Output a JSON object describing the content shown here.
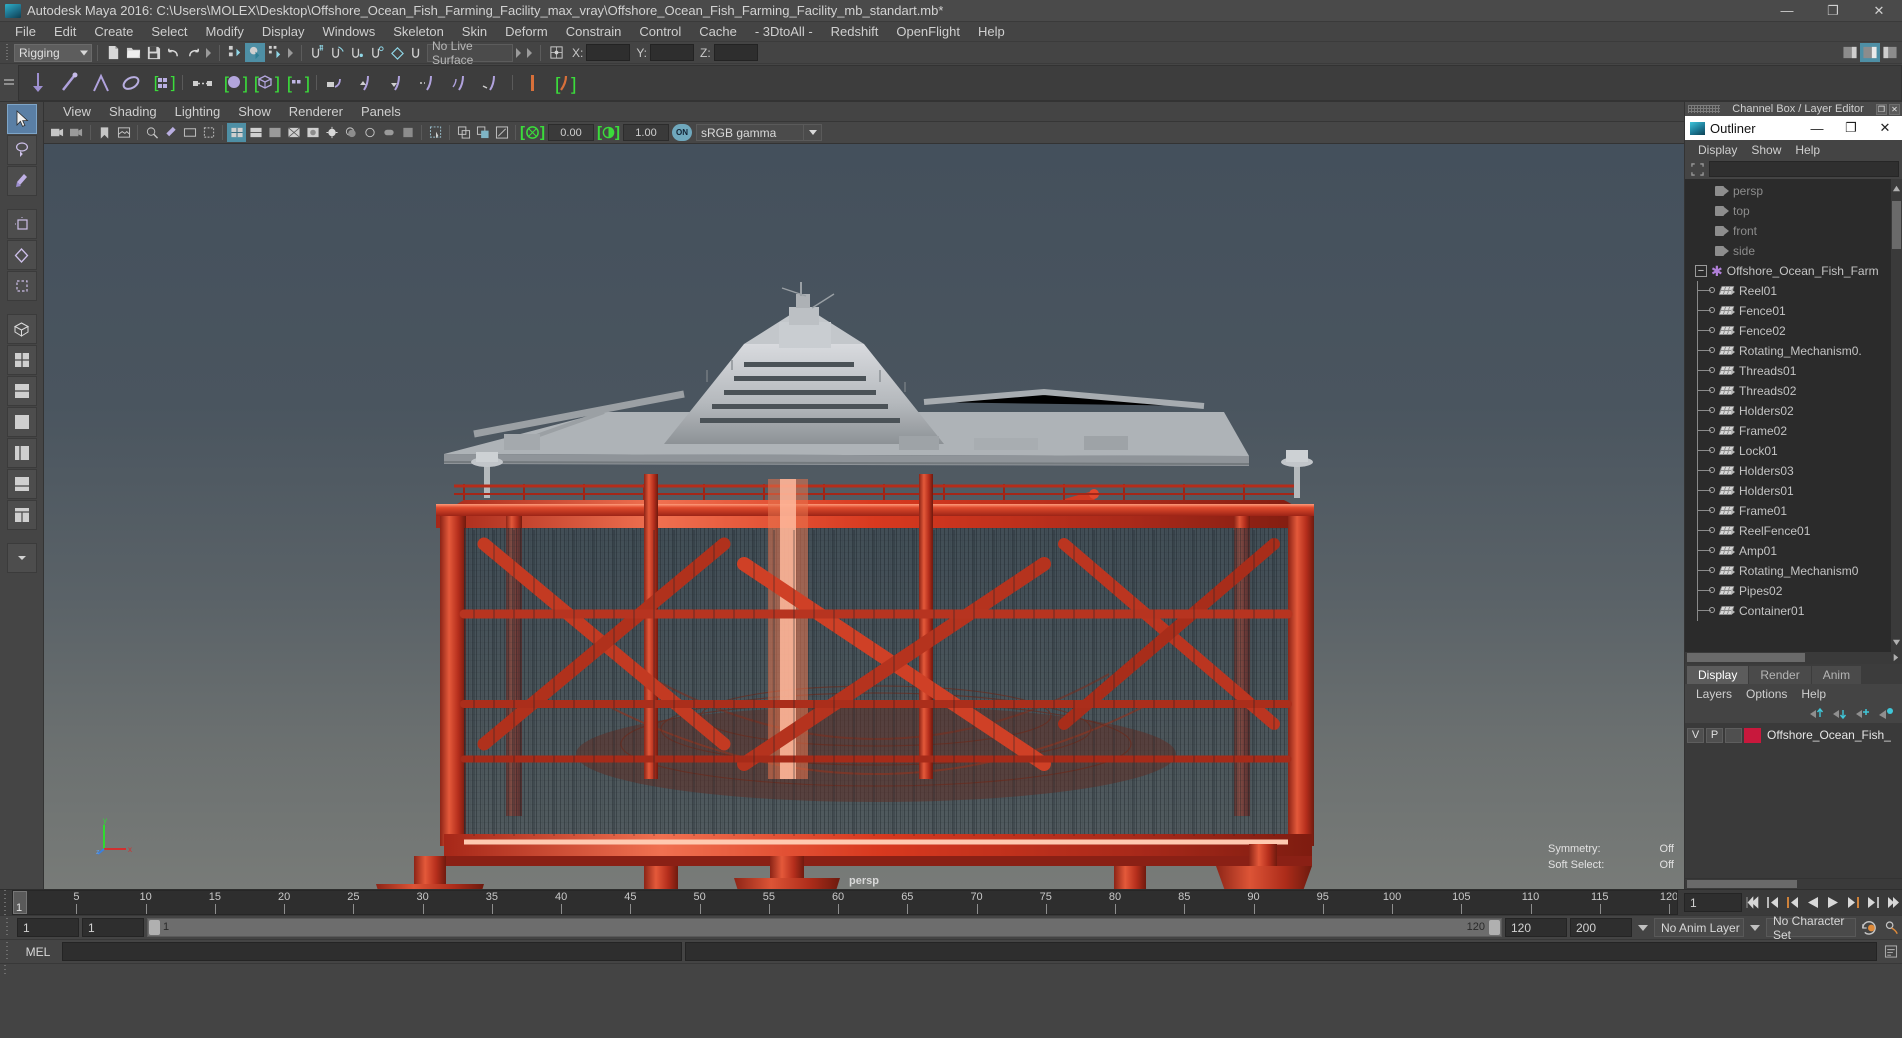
{
  "title_bar": {
    "app_icon": "maya-icon",
    "title": "Autodesk Maya 2016: C:\\Users\\MOLEX\\Desktop\\Offshore_Ocean_Fish_Farming_Facility_max_vray\\Offshore_Ocean_Fish_Farming_Facility_mb_standart.mb*",
    "minimize": "—",
    "maximize": "❐",
    "close": "✕"
  },
  "menu_bar": {
    "items": [
      {
        "label": "File"
      },
      {
        "label": "Edit"
      },
      {
        "label": "Create"
      },
      {
        "label": "Select"
      },
      {
        "label": "Modify"
      },
      {
        "label": "Display"
      },
      {
        "label": "Windows"
      },
      {
        "label": "Skeleton"
      },
      {
        "label": "Skin"
      },
      {
        "label": "Deform"
      },
      {
        "label": "Constrain"
      },
      {
        "label": "Control"
      },
      {
        "label": "Cache"
      },
      {
        "label": "- 3DtoAll -"
      },
      {
        "label": "Redshift"
      },
      {
        "label": "OpenFlight"
      },
      {
        "label": "Help"
      }
    ]
  },
  "status_line": {
    "menu_set": "Rigging",
    "live_surface": "No Live Surface",
    "coord_x_label": "X:",
    "coord_y_label": "Y:",
    "coord_z_label": "Z:",
    "coord_x_value": "",
    "coord_y_value": "",
    "coord_z_value": ""
  },
  "viewport_panel": {
    "menu": [
      {
        "label": "View"
      },
      {
        "label": "Shading"
      },
      {
        "label": "Lighting"
      },
      {
        "label": "Show"
      },
      {
        "label": "Renderer"
      },
      {
        "label": "Panels"
      }
    ],
    "exposure_value": "0.00",
    "gamma_value": "1.00",
    "color_management_toggle": "ON",
    "color_profile": "sRGB gamma",
    "camera_label": "persp",
    "symmetry_label": "Symmetry:",
    "symmetry_value": "Off",
    "soft_select_label": "Soft Select:",
    "soft_select_value": "Off",
    "axis_x": "x",
    "axis_y": "y",
    "axis_z": "z"
  },
  "channel_box_header": {
    "title": "Channel Box / Layer Editor",
    "restore": "❐",
    "close": "✕"
  },
  "outliner": {
    "title": "Outliner",
    "minimize": "—",
    "maximize": "❐",
    "close": "✕",
    "menu": [
      {
        "label": "Display"
      },
      {
        "label": "Show"
      },
      {
        "label": "Help"
      }
    ],
    "search_placeholder": "",
    "search_value": "",
    "cameras": [
      {
        "label": "persp"
      },
      {
        "label": "top"
      },
      {
        "label": "front"
      },
      {
        "label": "side"
      }
    ],
    "root_node": "Offshore_Ocean_Fish_Farm",
    "nodes": [
      {
        "label": "Reel01"
      },
      {
        "label": "Fence01"
      },
      {
        "label": "Fence02"
      },
      {
        "label": "Rotating_Mechanism0."
      },
      {
        "label": "Threads01"
      },
      {
        "label": "Threads02"
      },
      {
        "label": "Holders02"
      },
      {
        "label": "Frame02"
      },
      {
        "label": "Lock01"
      },
      {
        "label": "Holders03"
      },
      {
        "label": "Holders01"
      },
      {
        "label": "Frame01"
      },
      {
        "label": "ReelFence01"
      },
      {
        "label": "Amp01"
      },
      {
        "label": "Rotating_Mechanism0"
      },
      {
        "label": "Pipes02"
      },
      {
        "label": "Container01"
      }
    ]
  },
  "layer_editor": {
    "tabs": [
      {
        "label": "Display",
        "active": true
      },
      {
        "label": "Render",
        "active": false
      },
      {
        "label": "Anim",
        "active": false
      }
    ],
    "menu": [
      {
        "label": "Layers"
      },
      {
        "label": "Options"
      },
      {
        "label": "Help"
      }
    ],
    "layers": [
      {
        "visibility": "V",
        "playback": "P",
        "type": "",
        "color": "#c8183c",
        "name": "Offshore_Ocean_Fish_"
      }
    ]
  },
  "time_slider": {
    "ticks": [
      5,
      10,
      15,
      20,
      25,
      30,
      35,
      40,
      45,
      50,
      55,
      60,
      65,
      70,
      75,
      80,
      85,
      90,
      95,
      100,
      105,
      110,
      115,
      120
    ],
    "current_frame_marker": "1",
    "current_frame_field": "1",
    "playback_buttons": [
      "go-to-start",
      "step-back-key",
      "step-back-frame",
      "play-backwards",
      "play-forwards",
      "step-forward-frame",
      "step-forward-key",
      "go-to-end"
    ]
  },
  "range_slider": {
    "anim_start": "1",
    "range_start": "1",
    "bar_start_value": "1",
    "bar_end_value": "120",
    "range_end": "120",
    "anim_end": "200",
    "anim_layer": "No Anim Layer",
    "character_set": "No Character Set"
  },
  "command_line": {
    "language": "MEL",
    "input_value": "",
    "output_value": ""
  }
}
